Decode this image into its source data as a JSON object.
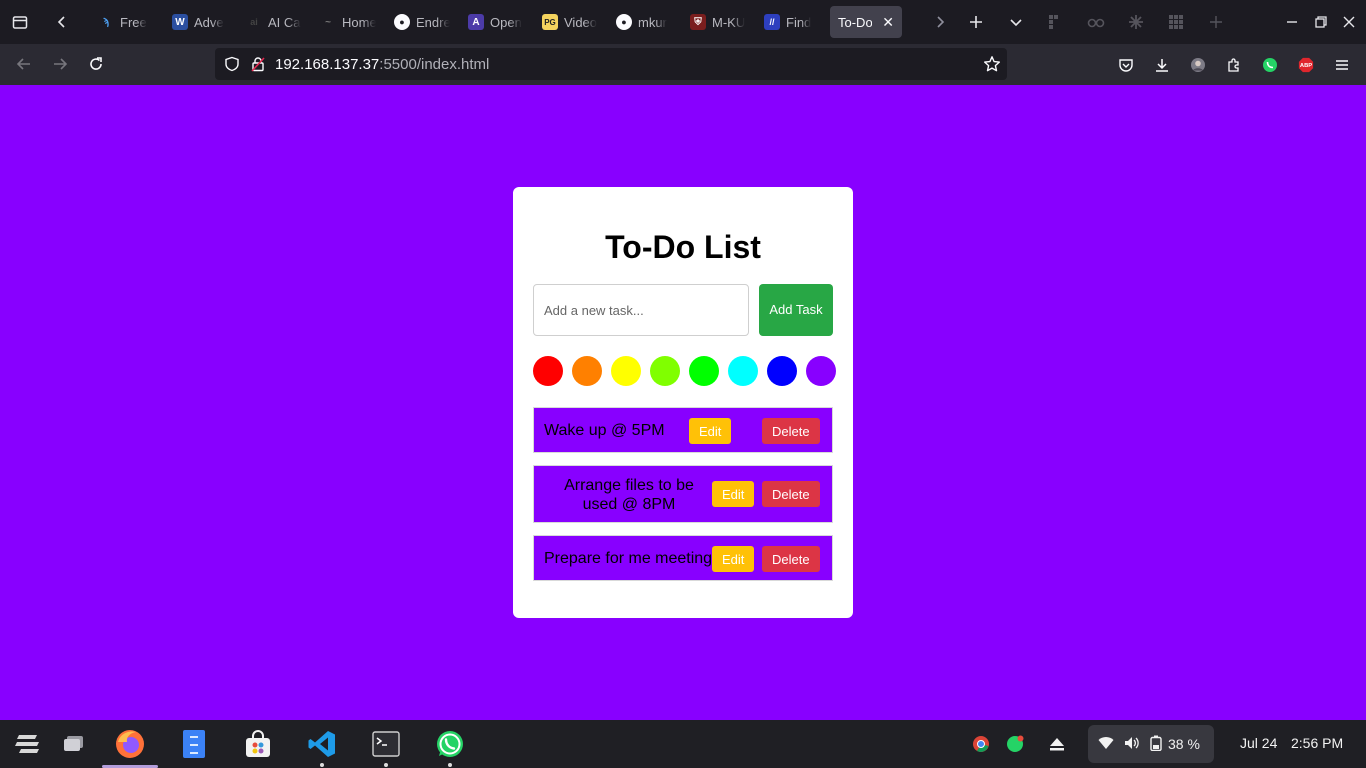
{
  "browser": {
    "tabs": [
      {
        "title": "Free",
        "favicon": "fingerprint-icon",
        "color": "#4ea1f3",
        "glyph": "ϡ"
      },
      {
        "title": "Adve",
        "favicon": "w-icon",
        "color": "#2b4fa0",
        "glyph": "W"
      },
      {
        "title": "AI Ca",
        "favicon": "ai-icon",
        "color": "#1c1b22",
        "glyph": "ai"
      },
      {
        "title": "Home",
        "favicon": "home-icon",
        "color": "#1c1b22",
        "glyph": "~"
      },
      {
        "title": "Endre",
        "favicon": "github-icon",
        "color": "#1c1b22",
        "glyph": "●"
      },
      {
        "title": "Open",
        "favicon": "a-icon",
        "color": "#4c3ba8",
        "glyph": "A"
      },
      {
        "title": "Video",
        "favicon": "pg-icon",
        "color": "#f4d35e",
        "glyph": "PG"
      },
      {
        "title": "mkur",
        "favicon": "github-icon",
        "color": "#1c1b22",
        "glyph": "●"
      },
      {
        "title": "M-KU",
        "favicon": "shield-icon",
        "color": "#7a1e1e",
        "glyph": "⛨"
      },
      {
        "title": "Find",
        "favicon": "slash-icon",
        "color": "#2d3fbf",
        "glyph": "//"
      }
    ],
    "active_tab": {
      "title": "To-Do"
    },
    "url": {
      "host": "192.168.137.37",
      "rest": ":5500/index.html"
    }
  },
  "todo": {
    "title": "To-Do List",
    "input_placeholder": "Add a new task...",
    "add_button_label": "Add Task",
    "swatches": [
      "#ff0000",
      "#ff8000",
      "#ffff00",
      "#80ff00",
      "#00ff00",
      "#00ffff",
      "#0000ff",
      "#8800ff"
    ],
    "tasks": [
      {
        "text": "Wake up @ 5PM",
        "edit_label": "Edit",
        "delete_label": "Delete"
      },
      {
        "text": "Arrange files to be used @ 8PM",
        "edit_label": "Edit",
        "delete_label": "Delete"
      },
      {
        "text": "Prepare for me meeting",
        "edit_label": "Edit",
        "delete_label": "Delete"
      }
    ]
  },
  "taskbar": {
    "battery": "38 %",
    "date": "Jul 24",
    "time": "2:56 PM"
  }
}
